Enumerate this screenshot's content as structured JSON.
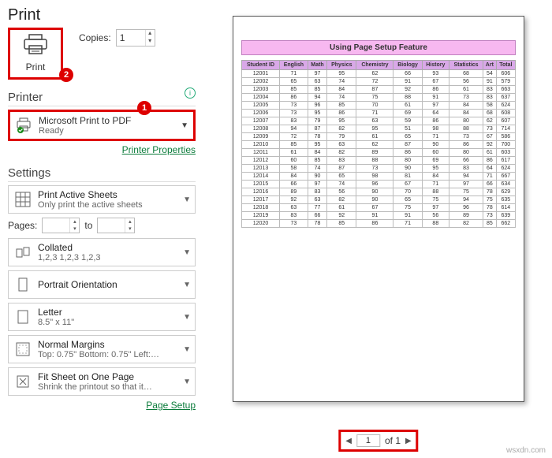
{
  "title": "Print",
  "print_button": "Print",
  "copies": {
    "label": "Copies:",
    "value": "1"
  },
  "annot": {
    "one": "1",
    "two": "2"
  },
  "printer": {
    "head": "Printer",
    "name": "Microsoft Print to PDF",
    "status": "Ready",
    "link": "Printer Properties"
  },
  "settings_head": "Settings",
  "pages": {
    "label": "Pages:",
    "to": "to"
  },
  "settings": [
    {
      "l1": "Print Active Sheets",
      "l2": "Only print the active sheets"
    },
    {
      "l1": "Collated",
      "l2": "1,2,3   1,2,3   1,2,3"
    },
    {
      "l1": "Portrait Orientation",
      "l2": ""
    },
    {
      "l1": "Letter",
      "l2": "8.5\" x 11\""
    },
    {
      "l1": "Normal Margins",
      "l2": "Top: 0.75\" Bottom: 0.75\" Left:…"
    },
    {
      "l1": "Fit Sheet on One Page",
      "l2": "Shrink the printout so that it…"
    }
  ],
  "page_setup": "Page Setup",
  "preview_title": "Using Page Setup Feature",
  "table": {
    "headers": [
      "Student ID",
      "English",
      "Math",
      "Physics",
      "Chemistry",
      "Biology",
      "History",
      "Statistics",
      "Art",
      "Total"
    ],
    "rows": [
      [
        "12001",
        "71",
        "97",
        "95",
        "62",
        "66",
        "93",
        "68",
        "54",
        "606"
      ],
      [
        "12002",
        "65",
        "63",
        "74",
        "72",
        "91",
        "67",
        "56",
        "91",
        "579"
      ],
      [
        "12003",
        "85",
        "85",
        "84",
        "87",
        "92",
        "86",
        "61",
        "83",
        "663"
      ],
      [
        "12004",
        "86",
        "94",
        "74",
        "75",
        "88",
        "91",
        "73",
        "83",
        "637"
      ],
      [
        "12005",
        "73",
        "96",
        "85",
        "70",
        "61",
        "97",
        "84",
        "58",
        "624"
      ],
      [
        "12006",
        "73",
        "95",
        "86",
        "71",
        "69",
        "64",
        "84",
        "68",
        "608"
      ],
      [
        "12007",
        "83",
        "79",
        "95",
        "63",
        "59",
        "86",
        "80",
        "62",
        "607"
      ],
      [
        "12008",
        "94",
        "87",
        "82",
        "95",
        "51",
        "98",
        "88",
        "73",
        "714"
      ],
      [
        "12009",
        "72",
        "78",
        "79",
        "61",
        "65",
        "71",
        "73",
        "67",
        "586"
      ],
      [
        "12010",
        "85",
        "95",
        "63",
        "62",
        "87",
        "90",
        "86",
        "92",
        "700"
      ],
      [
        "12011",
        "61",
        "84",
        "82",
        "89",
        "86",
        "60",
        "80",
        "61",
        "603"
      ],
      [
        "12012",
        "60",
        "85",
        "83",
        "88",
        "80",
        "69",
        "66",
        "86",
        "617"
      ],
      [
        "12013",
        "58",
        "74",
        "87",
        "73",
        "90",
        "95",
        "83",
        "64",
        "624"
      ],
      [
        "12014",
        "84",
        "90",
        "65",
        "98",
        "81",
        "84",
        "94",
        "71",
        "667"
      ],
      [
        "12015",
        "66",
        "97",
        "74",
        "96",
        "67",
        "71",
        "97",
        "66",
        "634"
      ],
      [
        "12016",
        "89",
        "83",
        "56",
        "90",
        "70",
        "88",
        "75",
        "78",
        "629"
      ],
      [
        "12017",
        "92",
        "63",
        "82",
        "90",
        "65",
        "75",
        "94",
        "75",
        "635"
      ],
      [
        "12018",
        "63",
        "77",
        "61",
        "67",
        "75",
        "97",
        "96",
        "78",
        "614"
      ],
      [
        "12019",
        "83",
        "66",
        "92",
        "91",
        "91",
        "56",
        "89",
        "73",
        "639"
      ],
      [
        "12020",
        "73",
        "78",
        "85",
        "86",
        "71",
        "88",
        "82",
        "85",
        "662"
      ]
    ]
  },
  "pager": {
    "current": "1",
    "of": "of 1"
  },
  "wm": "wsxdn.com"
}
